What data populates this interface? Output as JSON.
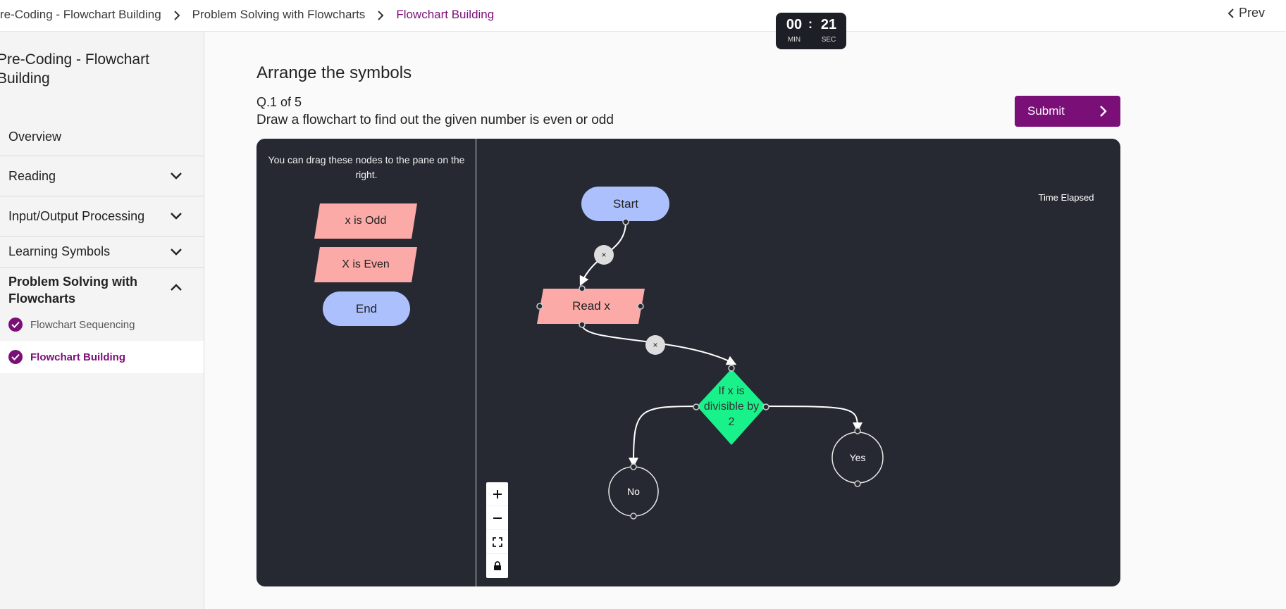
{
  "breadcrumb": {
    "items": [
      "re-Coding - Flowchart Building",
      "Problem Solving with Flowcharts",
      "Flowchart Building"
    ],
    "prev_label": "Prev"
  },
  "sidebar": {
    "title": "Pre-Coding - Flowchart Building",
    "items": [
      {
        "label": "Overview"
      },
      {
        "label": "Reading"
      },
      {
        "label": "Input/Output Processing"
      },
      {
        "label": "Learning Symbols"
      }
    ],
    "open_section": {
      "label": "Problem Solving with Flowcharts",
      "lessons": [
        {
          "label": "Flowchart Sequencing",
          "completed": true
        },
        {
          "label": "Flowchart Building",
          "completed": true,
          "current": true
        }
      ]
    }
  },
  "main": {
    "heading": "Arrange the symbols",
    "question_number": "Q.1 of 5",
    "question_text": "Draw a flowchart to find out the given number is even or odd",
    "submit_label": "Submit"
  },
  "palette": {
    "hint": "You can drag these nodes to the pane on the right.",
    "nodes": [
      "x is Odd",
      "X is Even",
      "End"
    ]
  },
  "canvas": {
    "nodes": {
      "start": "Start",
      "read": "Read x",
      "decision": [
        "If x is",
        "divisible by",
        "2"
      ],
      "yes": "Yes",
      "no": "No"
    },
    "edge_delete_label": "×"
  },
  "timer": {
    "minutes": "00",
    "seconds": "21",
    "min_label": "MIN",
    "sec_label": "SEC",
    "caption": "Time Elapsed"
  },
  "colors": {
    "brand": "#7a0f78",
    "board_bg": "#262932",
    "terminal": "#abc0fc",
    "io": "#fbaaa7",
    "decision": "#19f28a"
  }
}
